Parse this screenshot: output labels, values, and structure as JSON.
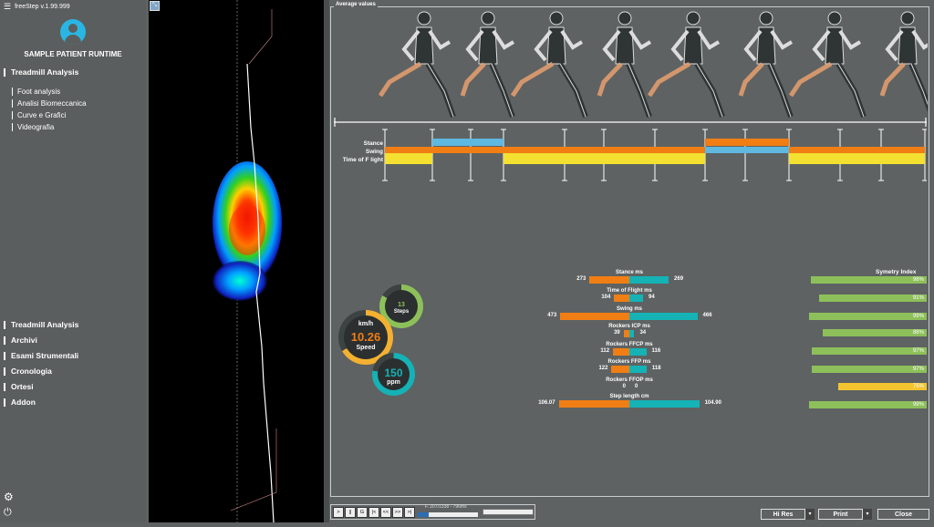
{
  "app": {
    "title": "freeStep v.1.99.999"
  },
  "patient": {
    "name": "SAMPLE PATIENT RUNTIME"
  },
  "nav_main": {
    "label": "Treadmill Analysis"
  },
  "nav_sub": [
    "Foot analysis",
    "Analisi Biomeccanica",
    "Curve e Grafici",
    "Videografia"
  ],
  "nav_bottom": [
    "Treadmill Analysis",
    "Archivi",
    "Esami Strumentali",
    "Cronologia",
    "Ortesi",
    "Addon"
  ],
  "icons": {
    "menu": "hamburger-icon",
    "avatar": "user-avatar-icon",
    "settings": "gear-icon",
    "power": "power-icon",
    "tool": "tool-icon"
  },
  "avg": {
    "title": "Average values"
  },
  "gait_labels": [
    "Stance",
    "Swing",
    "Time of F light"
  ],
  "metrics": [
    {
      "label": "Stance ms",
      "left": "273",
      "right": "269",
      "lv": 273,
      "rv": 269
    },
    {
      "label": "Time of Flight ms",
      "left": "104",
      "right": "94",
      "lv": 104,
      "rv": 94
    },
    {
      "label": "Swing ms",
      "left": "473",
      "right": "466",
      "lv": 473,
      "rv": 466
    },
    {
      "label": "Rockers ICP ms",
      "left": "39",
      "right": "34",
      "lv": 39,
      "rv": 34
    },
    {
      "label": "Rockers FFCP ms",
      "left": "112",
      "right": "116",
      "lv": 112,
      "rv": 116
    },
    {
      "label": "Rockers FFP ms",
      "left": "122",
      "right": "118",
      "lv": 122,
      "rv": 118
    },
    {
      "label": "Rockers FFOP ms",
      "left": "0",
      "right": "0",
      "lv": 0,
      "rv": 0
    },
    {
      "label": "Step length cm",
      "left": "106.07",
      "right": "104.90",
      "lv": 106.07,
      "rv": 104.9
    }
  ],
  "symmetry": {
    "title": "Symetry Index",
    "values": [
      "98%",
      "91%",
      "99%",
      "88%",
      "97%",
      "97%",
      "75%",
      "99%"
    ],
    "pct": [
      98,
      91,
      99,
      88,
      97,
      97,
      75,
      99
    ],
    "colors": [
      "#8dc05a",
      "#8dc05a",
      "#8dc05a",
      "#8dc05a",
      "#8dc05a",
      "#8dc05a",
      "#f4c430",
      "#8dc05a"
    ]
  },
  "gauges": {
    "steps": {
      "value": "13",
      "label": "Steps"
    },
    "speed": {
      "unit": "km/h",
      "value": "10.26",
      "label": "Speed"
    },
    "cadence": {
      "value": "150",
      "label": "ppm"
    }
  },
  "colors": {
    "orange": "#f07e14",
    "teal": "#15b2b6",
    "green": "#8dc05a",
    "yellow": "#f4c430",
    "blue": "#29b6e3"
  },
  "controls": {
    "buttons": [
      ">",
      "||",
      "G",
      "|<",
      "<<",
      ">>",
      ">|"
    ],
    "frame": "F. 207/1338 - 796ms",
    "progress": 0.18
  },
  "bottom_buttons": {
    "hires": "Hi Res",
    "print": "Print",
    "close": "Close"
  }
}
